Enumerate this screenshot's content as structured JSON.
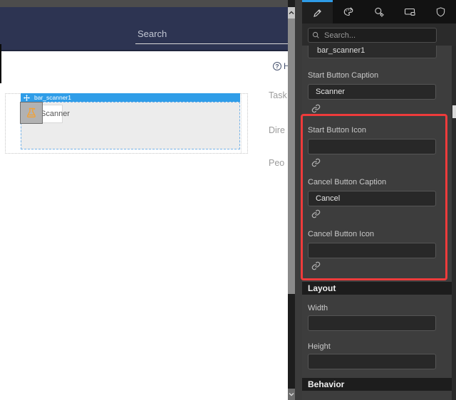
{
  "canvas": {
    "navbar": {
      "search_label": "Search"
    },
    "help": {
      "label": "H"
    },
    "widget": {
      "name": "bar_scanner1",
      "button_caption": "Scanner",
      "icon": "flask-icon"
    },
    "page_labels": [
      "Task",
      "Dire",
      "Peo"
    ]
  },
  "panel": {
    "tabs": [
      {
        "icon": "pencil-icon",
        "active": true
      },
      {
        "icon": "palette-icon",
        "active": false
      },
      {
        "icon": "interaction-gear-icon",
        "active": false
      },
      {
        "icon": "device-icon",
        "active": false
      },
      {
        "icon": "shield-icon",
        "active": false
      }
    ],
    "search": {
      "placeholder": "Search..."
    },
    "widget_name": "bar_scanner1",
    "fields": [
      {
        "label": "Start Button Caption",
        "value": "Scanner"
      },
      {
        "label": "Start Button Icon",
        "value": ""
      },
      {
        "label": "Cancel Button Caption",
        "value": "Cancel"
      },
      {
        "label": "Cancel Button Icon",
        "value": ""
      }
    ],
    "layout_section": {
      "title": "Layout",
      "fields": [
        {
          "label": "Width",
          "value": ""
        },
        {
          "label": "Height",
          "value": ""
        }
      ]
    },
    "behavior_section": {
      "title": "Behavior"
    }
  },
  "annotation": {
    "highlight_color": "#ee3b3b"
  },
  "colors": {
    "accent_blue": "#2e9be6",
    "selection_blue": "#2f9de8",
    "navy_header": "#2d3452",
    "panel_bg": "#3d3d3d"
  }
}
